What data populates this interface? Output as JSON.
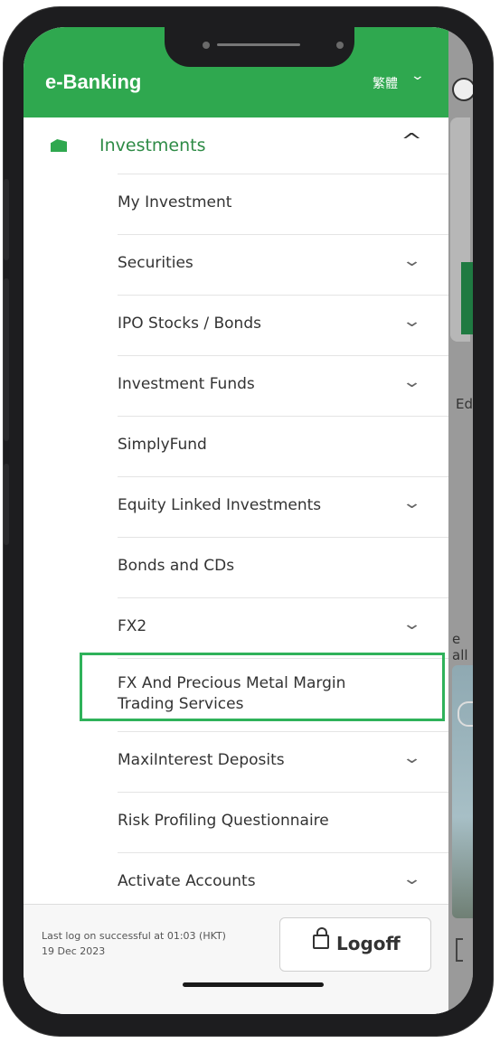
{
  "header": {
    "title": "e-Banking",
    "language": "繁體"
  },
  "section": {
    "label": "Investments"
  },
  "menu": [
    {
      "label": "My Investment",
      "expandable": false
    },
    {
      "label": "Securities",
      "expandable": true
    },
    {
      "label": "IPO Stocks / Bonds",
      "expandable": true
    },
    {
      "label": "Investment Funds",
      "expandable": true
    },
    {
      "label": "SimplyFund",
      "expandable": false
    },
    {
      "label": "Equity Linked Investments",
      "expandable": true
    },
    {
      "label": "Bonds and CDs",
      "expandable": false
    },
    {
      "label": "FX2",
      "expandable": true
    },
    {
      "label": "FX And Precious Metal Margin Trading Services",
      "expandable": false,
      "highlighted": true
    },
    {
      "label": "MaxiInterest Deposits",
      "expandable": true
    },
    {
      "label": "Risk Profiling Questionnaire",
      "expandable": false
    },
    {
      "label": "Activate Accounts",
      "expandable": true
    }
  ],
  "footer": {
    "last_log": "Last log on successful at 01:03 (HKT) 19 Dec 2023",
    "logoff_label": "Logoff"
  },
  "background": {
    "edit_label": "Edit",
    "see_all_label": "e all"
  },
  "colors": {
    "brand_green": "#2fa84f",
    "highlight_border": "#2fb25a"
  }
}
